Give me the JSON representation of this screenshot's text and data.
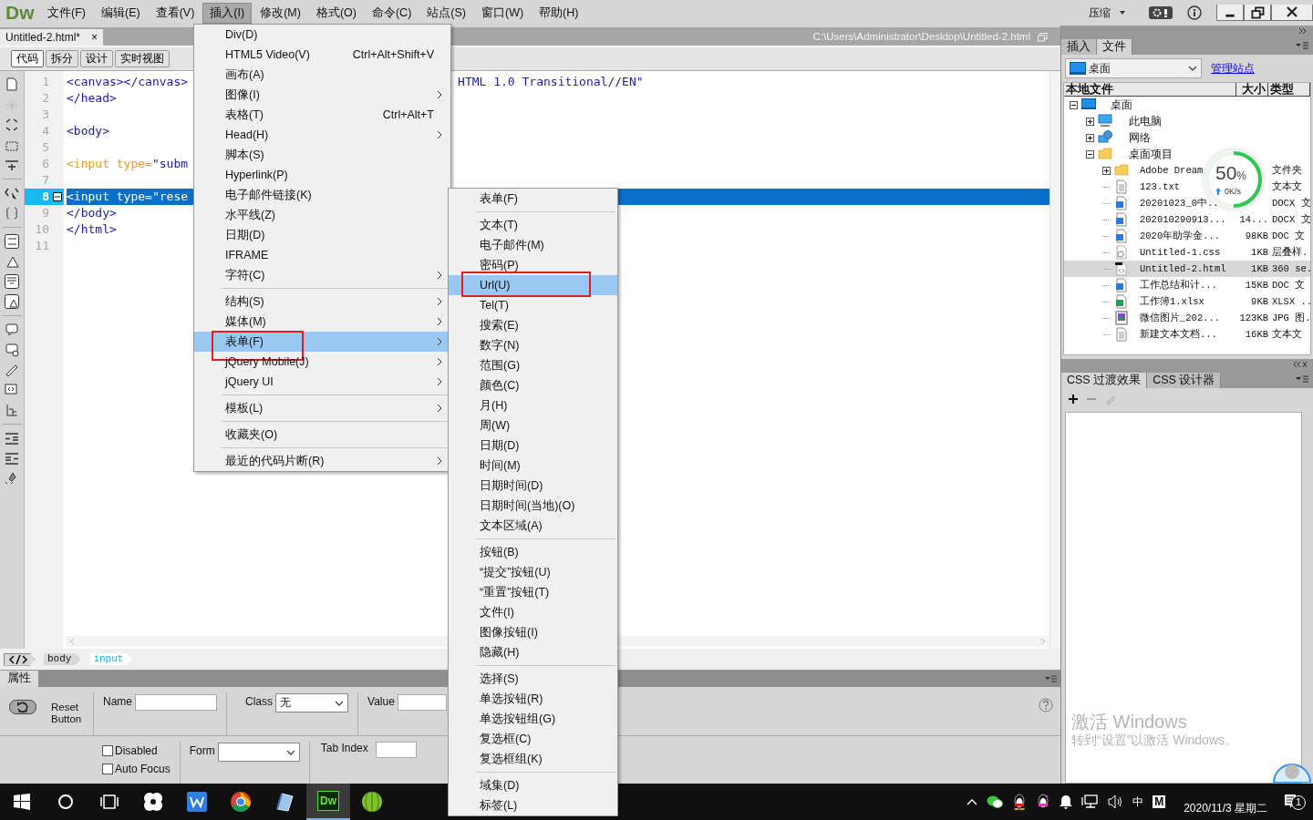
{
  "menubar": {
    "logo": "Dw",
    "menus": [
      {
        "label": "文件(F)",
        "selected": false
      },
      {
        "label": "编辑(E)",
        "selected": false
      },
      {
        "label": "查看(V)",
        "selected": false
      },
      {
        "label": "插入(I)",
        "selected": true
      },
      {
        "label": "修改(M)",
        "selected": false
      },
      {
        "label": "格式(O)",
        "selected": false
      },
      {
        "label": "命令(C)",
        "selected": false
      },
      {
        "label": "站点(S)",
        "selected": false
      },
      {
        "label": "窗口(W)",
        "selected": false
      },
      {
        "label": "帮助(H)",
        "selected": false
      }
    ],
    "workspace": "压缩"
  },
  "document_tab": {
    "title": "Untitled-2.html*",
    "close": "×",
    "path": "C:\\Users\\Administrator\\Desktop\\Untitled-2.html"
  },
  "view_buttons": [
    {
      "label": "代码",
      "selected": true
    },
    {
      "label": "拆分",
      "selected": false
    },
    {
      "label": "设计",
      "selected": false
    },
    {
      "label": "实时视图",
      "selected": false
    }
  ],
  "code_lines": [
    {
      "number": "1",
      "selected": false,
      "segments": [
        {
          "kind": "tag",
          "text": "<canvas></canvas>"
        },
        {
          "kind": "tail",
          "text": "HTML 1.0 Transitional//EN\""
        }
      ]
    },
    {
      "number": "2",
      "selected": false,
      "segments": [
        {
          "kind": "tag",
          "text": "</head>"
        }
      ]
    },
    {
      "number": "3",
      "selected": false
    },
    {
      "number": "4",
      "selected": false,
      "segments": [
        {
          "kind": "tag",
          "text": "<body>"
        }
      ]
    },
    {
      "number": "5",
      "selected": false
    },
    {
      "number": "6",
      "selected": false,
      "segments": [
        {
          "kind": "attr",
          "text": "<input type="
        },
        {
          "kind": "tag",
          "text": "\"subm"
        }
      ]
    },
    {
      "number": "7",
      "selected": false
    },
    {
      "number": "8",
      "selected": true,
      "foldable": true,
      "segments": [
        {
          "kind": "tag",
          "text": "<input type=\"rese"
        }
      ]
    },
    {
      "number": "9",
      "selected": false,
      "segments": [
        {
          "kind": "tag",
          "text": "</body>"
        }
      ]
    },
    {
      "number": "10",
      "selected": false,
      "segments": [
        {
          "kind": "tag",
          "text": "</html>"
        }
      ]
    },
    {
      "number": "11",
      "selected": false
    }
  ],
  "tag_selector": [
    {
      "label": "body",
      "selected": false
    },
    {
      "label": "input",
      "selected": true
    }
  ],
  "properties": {
    "title": "属性",
    "element_label": "Reset Button",
    "name_label": "Name",
    "class_label": "Class",
    "class_value": "无",
    "value_label": "Value",
    "checkboxes": [
      {
        "label": "Disabled",
        "checked": false
      },
      {
        "label": "Auto Focus",
        "checked": false
      }
    ],
    "form_label": "Form",
    "tab_index_label": "Tab Index"
  },
  "insert_menu": {
    "items": [
      {
        "kind": "item",
        "label": "Div(D)",
        "submenu": false,
        "selected": false,
        "annotated": false
      },
      {
        "kind": "item",
        "label": "HTML5 Video(V)",
        "shortcut": "Ctrl+Alt+Shift+V",
        "submenu": false,
        "selected": false,
        "annotated": false
      },
      {
        "kind": "item",
        "label": "画布(A)",
        "submenu": false,
        "selected": false,
        "annotated": false
      },
      {
        "kind": "item",
        "label": "图像(I)",
        "submenu": true,
        "selected": false,
        "annotated": false
      },
      {
        "kind": "item",
        "label": "表格(T)",
        "shortcut": "Ctrl+Alt+T",
        "submenu": false,
        "selected": false,
        "annotated": false
      },
      {
        "kind": "item",
        "label": "Head(H)",
        "submenu": true,
        "selected": false,
        "annotated": false
      },
      {
        "kind": "item",
        "label": "脚本(S)",
        "submenu": false,
        "selected": false,
        "annotated": false
      },
      {
        "kind": "item",
        "label": "Hyperlink(P)",
        "submenu": false,
        "selected": false,
        "annotated": false
      },
      {
        "kind": "item",
        "label": "电子邮件链接(K)",
        "submenu": false,
        "selected": false,
        "annotated": false
      },
      {
        "kind": "item",
        "label": "水平线(Z)",
        "submenu": false,
        "selected": false,
        "annotated": false
      },
      {
        "kind": "item",
        "label": "日期(D)",
        "submenu": false,
        "selected": false,
        "annotated": false
      },
      {
        "kind": "item",
        "label": "IFRAME",
        "submenu": false,
        "selected": false,
        "annotated": false
      },
      {
        "kind": "item",
        "label": "字符(C)",
        "submenu": true,
        "selected": false,
        "annotated": false
      },
      {
        "kind": "separator"
      },
      {
        "kind": "item",
        "label": "结构(S)",
        "submenu": true,
        "selected": false,
        "annotated": false
      },
      {
        "kind": "item",
        "label": "媒体(M)",
        "submenu": true,
        "selected": false,
        "annotated": false
      },
      {
        "kind": "item",
        "label": "表单(F)",
        "submenu": true,
        "selected": true,
        "annotated": true
      },
      {
        "kind": "item",
        "label": "jQuery Mobile(J)",
        "submenu": true,
        "selected": false,
        "annotated": false
      },
      {
        "kind": "item",
        "label": "jQuery UI",
        "submenu": true,
        "selected": false,
        "annotated": false
      },
      {
        "kind": "separator"
      },
      {
        "kind": "item",
        "label": "模板(L)",
        "submenu": true,
        "selected": false,
        "annotated": false
      },
      {
        "kind": "separator"
      },
      {
        "kind": "item",
        "label": "收藏夹(O)",
        "submenu": false,
        "selected": false,
        "annotated": false
      },
      {
        "kind": "separator"
      },
      {
        "kind": "item",
        "label": "最近的代码片断(R)",
        "submenu": true,
        "selected": false,
        "annotated": false
      }
    ]
  },
  "form_submenu": {
    "items": [
      {
        "kind": "item",
        "label": "表单(F)",
        "submenu": false,
        "selected": false,
        "annotated": false
      },
      {
        "kind": "separator"
      },
      {
        "kind": "item",
        "label": "文本(T)",
        "submenu": false,
        "selected": false,
        "annotated": false
      },
      {
        "kind": "item",
        "label": "电子邮件(M)",
        "submenu": false,
        "selected": false,
        "annotated": false
      },
      {
        "kind": "item",
        "label": "密码(P)",
        "submenu": false,
        "selected": false,
        "annotated": false
      },
      {
        "kind": "item",
        "label": "Url(U)",
        "submenu": false,
        "selected": true,
        "annotated": true
      },
      {
        "kind": "item",
        "label": "Tel(T)",
        "submenu": false,
        "selected": false,
        "annotated": false
      },
      {
        "kind": "item",
        "label": "搜索(E)",
        "submenu": false,
        "selected": false,
        "annotated": false
      },
      {
        "kind": "item",
        "label": "数字(N)",
        "submenu": false,
        "selected": false,
        "annotated": false
      },
      {
        "kind": "item",
        "label": "范围(G)",
        "submenu": false,
        "selected": false,
        "annotated": false
      },
      {
        "kind": "item",
        "label": "颜色(C)",
        "submenu": false,
        "selected": false,
        "annotated": false
      },
      {
        "kind": "item",
        "label": "月(H)",
        "submenu": false,
        "selected": false,
        "annotated": false
      },
      {
        "kind": "item",
        "label": "周(W)",
        "submenu": false,
        "selected": false,
        "annotated": false
      },
      {
        "kind": "item",
        "label": "日期(D)",
        "submenu": false,
        "selected": false,
        "annotated": false
      },
      {
        "kind": "item",
        "label": "时间(M)",
        "submenu": false,
        "selected": false,
        "annotated": false
      },
      {
        "kind": "item",
        "label": "日期时间(D)",
        "submenu": false,
        "selected": false,
        "annotated": false
      },
      {
        "kind": "item",
        "label": "日期时间(当地)(O)",
        "submenu": false,
        "selected": false,
        "annotated": false
      },
      {
        "kind": "item",
        "label": "文本区域(A)",
        "submenu": false,
        "selected": false,
        "annotated": false
      },
      {
        "kind": "separator"
      },
      {
        "kind": "item",
        "label": "按钮(B)",
        "submenu": false,
        "selected": false,
        "annotated": false
      },
      {
        "kind": "item",
        "label": "“提交”按钮(U)",
        "submenu": false,
        "selected": false,
        "annotated": false
      },
      {
        "kind": "item",
        "label": "“重置”按钮(T)",
        "submenu": false,
        "selected": false,
        "annotated": false
      },
      {
        "kind": "item",
        "label": "文件(I)",
        "submenu": false,
        "selected": false,
        "annotated": false
      },
      {
        "kind": "item",
        "label": "图像按钮(I)",
        "submenu": false,
        "selected": false,
        "annotated": false
      },
      {
        "kind": "item",
        "label": "隐藏(H)",
        "submenu": false,
        "selected": false,
        "annotated": false
      },
      {
        "kind": "separator"
      },
      {
        "kind": "item",
        "label": "选择(S)",
        "submenu": false,
        "selected": false,
        "annotated": false
      },
      {
        "kind": "item",
        "label": "单选按钮(R)",
        "submenu": false,
        "selected": false,
        "annotated": false
      },
      {
        "kind": "item",
        "label": "单选按钮组(G)",
        "submenu": false,
        "selected": false,
        "annotated": false
      },
      {
        "kind": "item",
        "label": "复选框(C)",
        "submenu": false,
        "selected": false,
        "annotated": false
      },
      {
        "kind": "item",
        "label": "复选框组(K)",
        "submenu": false,
        "selected": false,
        "annotated": false
      },
      {
        "kind": "separator"
      },
      {
        "kind": "item",
        "label": "域集(D)",
        "submenu": false,
        "selected": false,
        "annotated": false
      },
      {
        "kind": "item",
        "label": "标签(L)",
        "submenu": false,
        "selected": false,
        "annotated": false
      }
    ]
  },
  "files_panel": {
    "tabs": [
      {
        "label": "插入",
        "selected": false
      },
      {
        "label": "文件",
        "selected": true
      }
    ],
    "site": "桌面",
    "manage_link": "管理站点",
    "columns": [
      "本地文件",
      "大小",
      "类型"
    ],
    "tree": [
      {
        "kind": "desktop",
        "name": "桌面",
        "expanded": true,
        "selected": false,
        "children": [
          {
            "kind": "computer",
            "name": "此电脑",
            "expanded": false,
            "selected": false
          },
          {
            "kind": "network",
            "name": "网络",
            "expanded": false,
            "selected": false
          },
          {
            "kind": "folder",
            "name": "桌面项目",
            "expanded": true,
            "selected": false,
            "children": [
              {
                "kind": "folder",
                "name": "Adobe Dream",
                "type": "文件夹",
                "expanded": false,
                "selected": false
              },
              {
                "kind": "text",
                "name": "123.txt",
                "type": "文本文",
                "selected": false
              },
              {
                "kind": "word",
                "name": "20201023_0中...",
                "type": "DOCX 文",
                "selected": false
              },
              {
                "kind": "word",
                "name": "202010290913...",
                "size": "14...",
                "type": "DOCX 文",
                "selected": false
              },
              {
                "kind": "word",
                "name": "2020年助学金...",
                "size": "98KB",
                "type": "DOC 文",
                "selected": false
              },
              {
                "kind": "css",
                "name": "Untitled-1.css",
                "size": "1KB",
                "type": "层叠样.",
                "selected": false
              },
              {
                "kind": "html",
                "name": "Untitled-2.html",
                "size": "1KB",
                "type": "360 se.",
                "selected": true
              },
              {
                "kind": "word",
                "name": "工作总结和计...",
                "size": "15KB",
                "type": "DOC 文",
                "selected": false
              },
              {
                "kind": "excel",
                "name": "工作簿1.xlsx",
                "size": "9KB",
                "type": "XLSX ..",
                "selected": false
              },
              {
                "kind": "image",
                "name": "微信图片_202...",
                "size": "123KB",
                "type": "JPG 图.",
                "selected": false
              },
              {
                "kind": "text",
                "name": "新建文本文档...",
                "size": "16KB",
                "type": "文本文",
                "selected": false
              }
            ]
          }
        ]
      }
    ]
  },
  "speed_widget": {
    "percent": "50",
    "unit": "%",
    "rate": "0K/s",
    "level": 0.5
  },
  "css_panel": {
    "tabs": [
      {
        "label": "CSS 过渡效果",
        "selected": true
      },
      {
        "label": "CSS 设计器",
        "selected": false
      }
    ]
  },
  "activation": {
    "title": "激活 Windows",
    "message": "转到“设置”以激活 Windows。"
  },
  "taskbar": {
    "apps": [
      {
        "kind": "explorer-pinwheel",
        "selected": false
      },
      {
        "kind": "wps",
        "selected": false
      },
      {
        "kind": "chrome",
        "selected": false
      },
      {
        "kind": "notebook",
        "selected": false
      },
      {
        "kind": "dreamweaver",
        "label": "Dw",
        "selected": true
      },
      {
        "kind": "ball",
        "selected": false
      }
    ],
    "ime": "中",
    "ime_mode": "M",
    "date": "2020/11/3 星期二",
    "notifications": "1"
  }
}
